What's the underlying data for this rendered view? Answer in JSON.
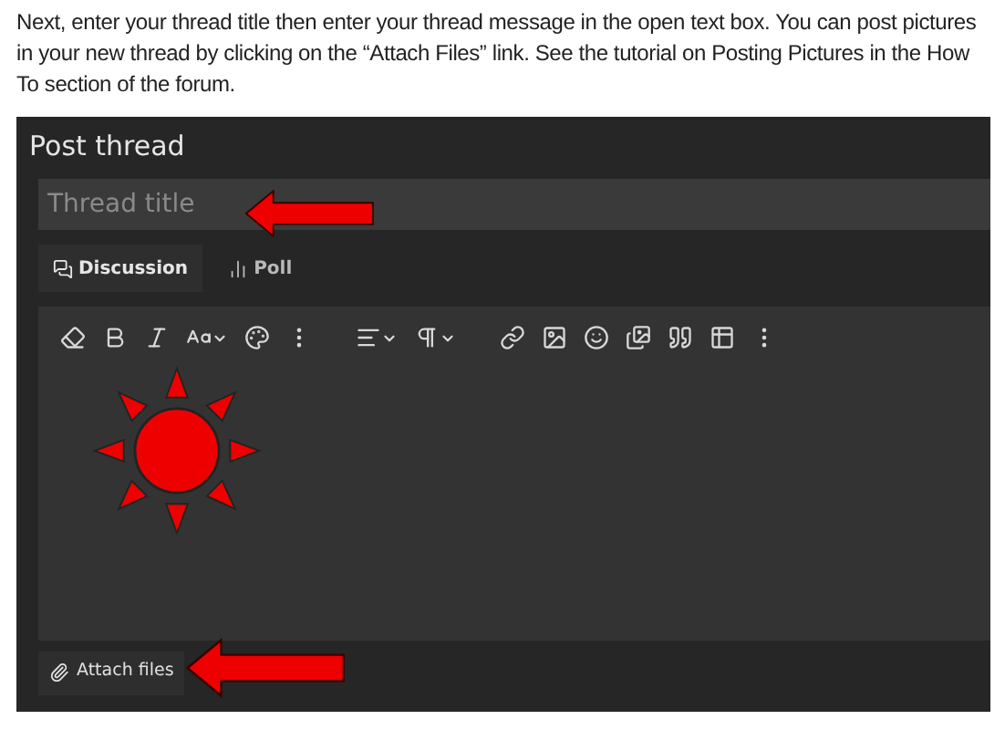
{
  "instructions": "Next, enter your thread title then enter your thread message in the open text box. You can post pictures in your new thread by clicking on the “Attach Files” link. See the tutorial on Posting Pictures in the How To section of the forum.",
  "panel": {
    "title": "Post thread"
  },
  "title_field": {
    "placeholder": "Thread title"
  },
  "tabs": [
    {
      "label": "Discussion",
      "selected": true,
      "kind": "discussion"
    },
    {
      "label": "Poll",
      "selected": false,
      "kind": "poll"
    }
  ],
  "attach_button": {
    "label": "Attach files"
  }
}
